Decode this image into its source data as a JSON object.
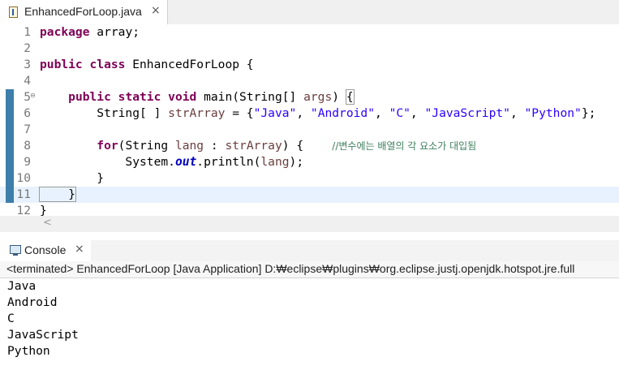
{
  "editor": {
    "tab": {
      "title": "EnhancedForLoop.java",
      "close": "×"
    },
    "lines": {
      "l1": {
        "n": "1",
        "kw": "package",
        "rest": " array;"
      },
      "l2": {
        "n": "2"
      },
      "l3": {
        "n": "3",
        "kw": "public class",
        "rest": " EnhancedForLoop {"
      },
      "l4": {
        "n": "4"
      },
      "l5": {
        "n": "5",
        "indent": "    ",
        "kw": "public static void",
        "mid": " main(String[] ",
        "param": "args",
        "paren": ") ",
        "brace": "{"
      },
      "l6": {
        "n": "6",
        "prefix": "        String[ ] ",
        "var": "strArray",
        "eq": " = {",
        "s1": "\"Java\"",
        "s2": "\"Android\"",
        "s3": "\"C\"",
        "s4": "\"JavaScript\"",
        "s5": "\"Python\"",
        "comma": ", ",
        "end": "};"
      },
      "l7": {
        "n": "7"
      },
      "l8": {
        "n": "8",
        "indent": "        ",
        "kw": "for",
        "open": "(String ",
        "v1": "lang",
        "colon": " : ",
        "v2": "strArray",
        "close": ") {    ",
        "comment": "//변수에는 배열의 각 요소가 대입됨"
      },
      "l9": {
        "n": "9",
        "indent": "            System.",
        "field": "out",
        "rest": ".println(",
        "v": "lang",
        "end": ");"
      },
      "l10": {
        "n": "10",
        "text": "        }"
      },
      "l11": {
        "n": "11",
        "text": "    }"
      },
      "l12": {
        "n": "12",
        "text": "}"
      }
    },
    "fold_marker": "⊖",
    "scroll_left": "<"
  },
  "console": {
    "tab": {
      "title": "Console",
      "close": "×"
    },
    "status": "<terminated> EnhancedForLoop [Java Application] D:₩eclipse₩plugins₩org.eclipse.justj.openjdk.hotspot.jre.full",
    "output": [
      "Java",
      "Android",
      "C",
      "JavaScript",
      "Python"
    ]
  },
  "colors": {
    "keyword": "#7f0055",
    "string": "#2a00ff",
    "static_field": "#0000c0",
    "local_variable": "#6a3e3e",
    "comment": "#3f7f5f",
    "current_line": "#e8f2fe",
    "change_ruler": "#3d7eab"
  }
}
